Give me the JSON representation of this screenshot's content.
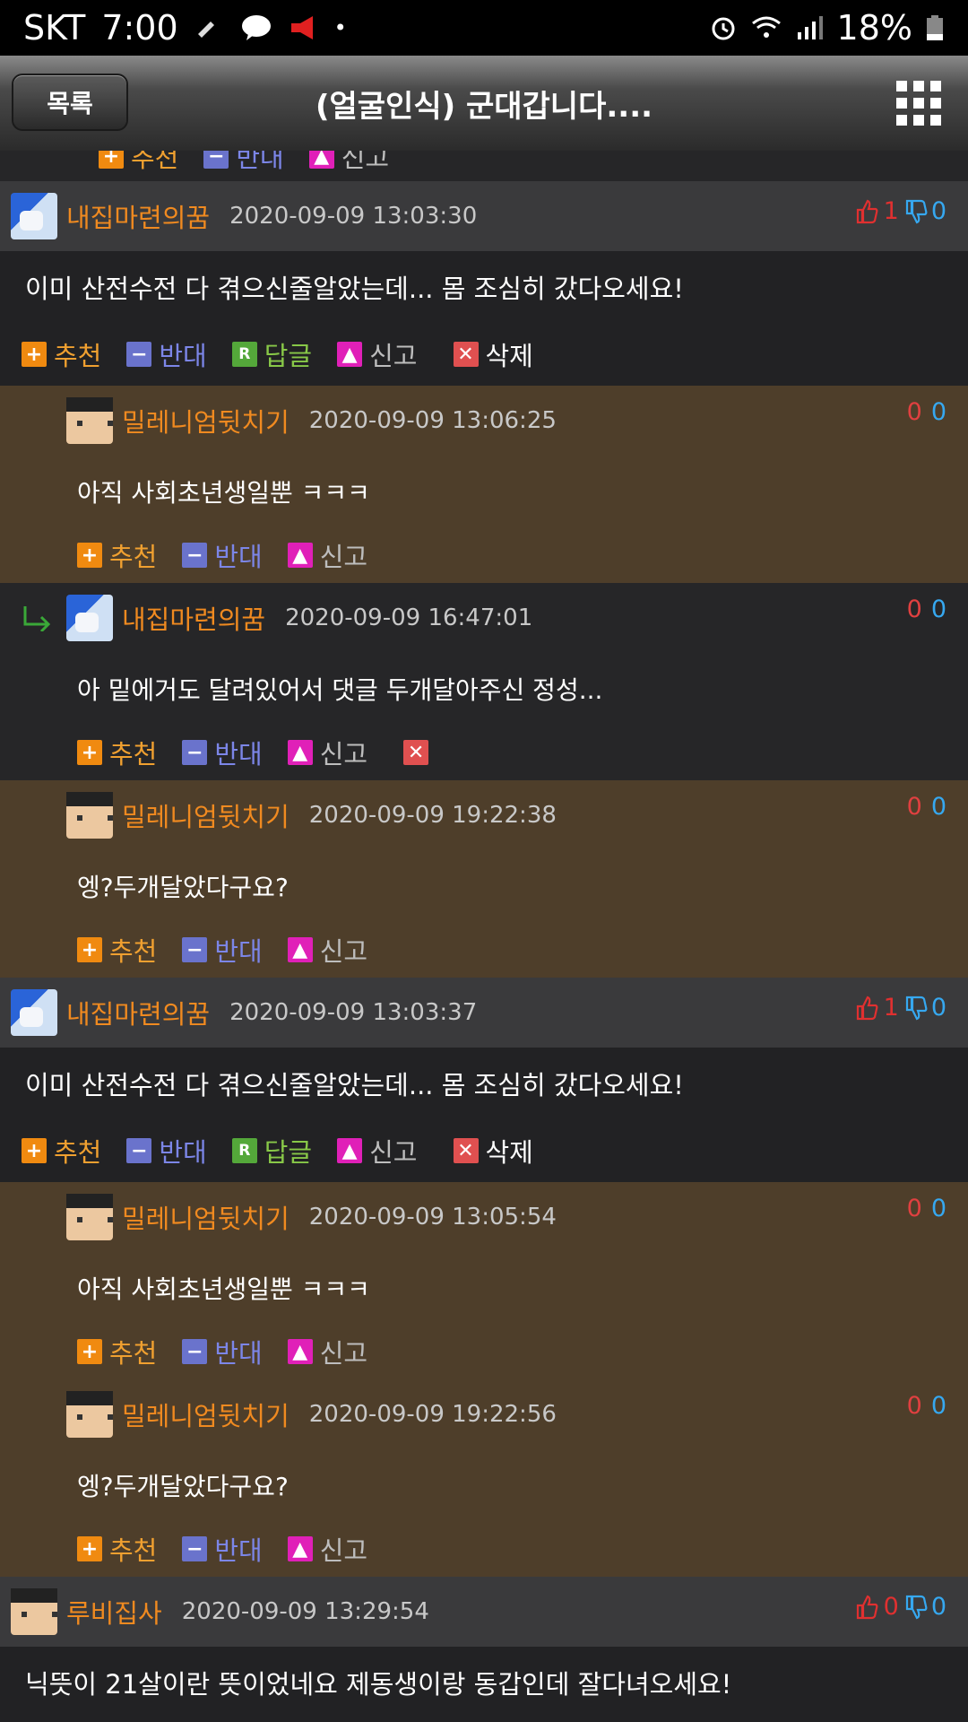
{
  "status": {
    "carrier": "SKT",
    "time": "7:00",
    "battery": "18%"
  },
  "header": {
    "back_label": "목록",
    "title": "(얼굴인식) 군대갑니다...."
  },
  "labels": {
    "recommend": "추천",
    "oppose": "반대",
    "reply": "답글",
    "report": "신고",
    "delete": "삭제"
  },
  "comments": [
    {
      "nick": "내집마련의꿈",
      "date": "2020-09-09 13:03:30",
      "up": "1",
      "down": "0",
      "text": "이미 산전수전 다 겪으신줄알았는데... 몸 조심히 갔다오세요!",
      "replies": [
        {
          "nick": "밀레니엄뒷치기",
          "date": "2020-09-09 13:06:25",
          "up": "0",
          "down": "0",
          "text": "아직 사회초년생일뿐 ㅋㅋㅋ"
        },
        {
          "nick": "내집마련의꿈",
          "date": "2020-09-09 16:47:01",
          "up": "0",
          "down": "0",
          "text": "아 밑에거도 달려있어서 댓글 두개달아주신 정성..."
        },
        {
          "nick": "밀레니엄뒷치기",
          "date": "2020-09-09 19:22:38",
          "up": "0",
          "down": "0",
          "text": "엥?두개달았다구요?"
        }
      ]
    },
    {
      "nick": "내집마련의꿈",
      "date": "2020-09-09 13:03:37",
      "up": "1",
      "down": "0",
      "text": "이미 산전수전 다 겪으신줄알았는데... 몸 조심히 갔다오세요!",
      "replies": [
        {
          "nick": "밀레니엄뒷치기",
          "date": "2020-09-09 13:05:54",
          "up": "0",
          "down": "0",
          "text": "아직 사회초년생일뿐 ㅋㅋㅋ"
        },
        {
          "nick": "밀레니엄뒷치기",
          "date": "2020-09-09 19:22:56",
          "up": "0",
          "down": "0",
          "text": "엥?두개달았다구요?"
        }
      ]
    },
    {
      "nick": "루비집사",
      "date": "2020-09-09 13:29:54",
      "up": "0",
      "down": "0",
      "text": "닉뜻이 21살이란 뜻이었네요 제동생이랑 동갑인데 잘다녀오세요!"
    }
  ]
}
